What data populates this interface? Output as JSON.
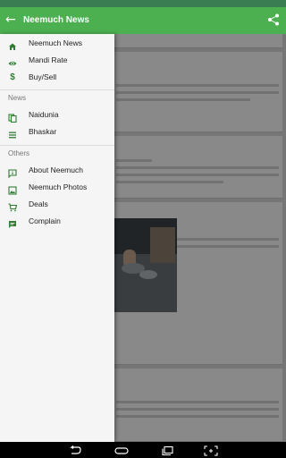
{
  "appbar": {
    "title": "Neemuch News",
    "back_icon": "arrow-back-icon",
    "share_icon": "share-icon"
  },
  "drawer": {
    "items_top": [
      {
        "label": "Neemuch News",
        "icon": "home-icon"
      },
      {
        "label": "Mandi Rate",
        "icon": "eye-icon"
      },
      {
        "label": "Buy/Sell",
        "icon": "dollar-icon"
      }
    ],
    "news_header": "News",
    "items_news": [
      {
        "label": "Naidunia",
        "icon": "copy-icon"
      },
      {
        "label": "Bhaskar",
        "icon": "list-icon"
      }
    ],
    "others_header": "Others",
    "items_others": [
      {
        "label": "About Neemuch",
        "icon": "info-chat-icon"
      },
      {
        "label": "Neemuch Photos",
        "icon": "photo-icon"
      },
      {
        "label": "Deals",
        "icon": "cart-icon"
      },
      {
        "label": "Complain",
        "icon": "chat-icon"
      }
    ]
  },
  "colors": {
    "primary": "#4caf50",
    "primary_dark": "#3a7d52",
    "accent_icon": "#2e7d32"
  },
  "navbar": {
    "back_icon": "nav-back-icon",
    "home_icon": "nav-home-icon",
    "recents_icon": "nav-recents-icon",
    "screenshot_icon": "screenshot-icon"
  }
}
